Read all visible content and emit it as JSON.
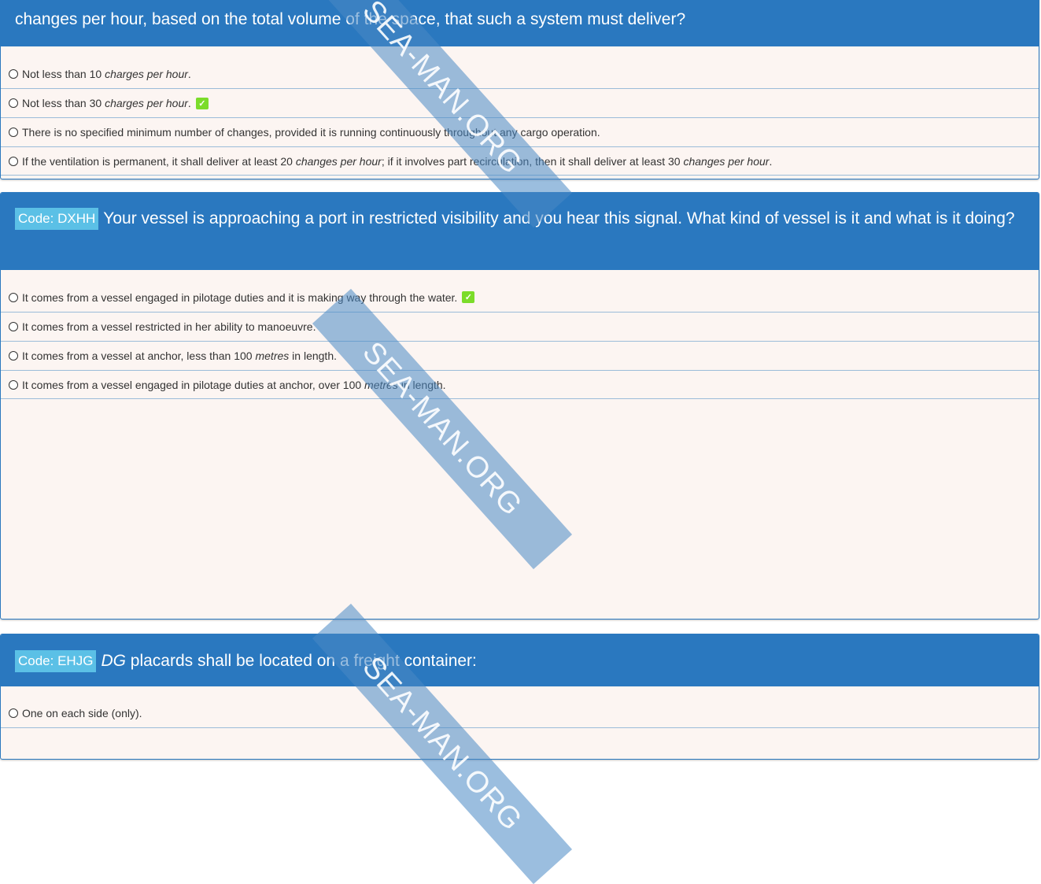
{
  "q1": {
    "question_tail": "changes per hour, based on the total volume of the space, that such a system must deliver?",
    "answers": [
      {
        "pre": "Not less than 10 ",
        "em": "charges per hour",
        "post": "."
      },
      {
        "pre": "Not less than 30 ",
        "em": "charges per hour",
        "post": "."
      },
      {
        "text": "There is no specified minimum number of changes, provided it is running continuously throughout any cargo operation."
      },
      {
        "pre": "If the ventilation is permanent, it shall deliver at least 20 ",
        "em": "changes per hour",
        "mid": "; if it involves part recirculation, then it shall deliver at least 30 ",
        "em2": "changes per hour",
        "post": "."
      }
    ]
  },
  "q2": {
    "code": "Code: DXHH",
    "question": "Your vessel is approaching a port in restricted visibility and you hear this signal. What kind of vessel is it and what is it doing?",
    "answers": [
      {
        "text": "It comes from a vessel engaged in pilotage duties and it is making way through the water."
      },
      {
        "text": "It comes from a vessel restricted in her ability to manoeuvre."
      },
      {
        "pre": "It comes from a vessel at anchor, less than 100 ",
        "em": "metres",
        "post": " in length."
      },
      {
        "pre": "It comes from a vessel engaged in pilotage duties at anchor, over 100 ",
        "em": "metres",
        "post": " in length."
      }
    ]
  },
  "q3": {
    "code": "Code: EHJG",
    "question_em": "DG",
    "question": " placards shall be located on a freight container:",
    "answers": [
      {
        "text": "One on each side (only)."
      }
    ]
  },
  "watermark": "SEA-MAN.ORG",
  "icons": {
    "correct": "check-mark-icon",
    "option": "radio-icon"
  },
  "colors": {
    "header": "#2a78bf",
    "badge": "#5bc0e6",
    "correct": "#7bdc2a",
    "card_bg": "#fcf5f2"
  }
}
